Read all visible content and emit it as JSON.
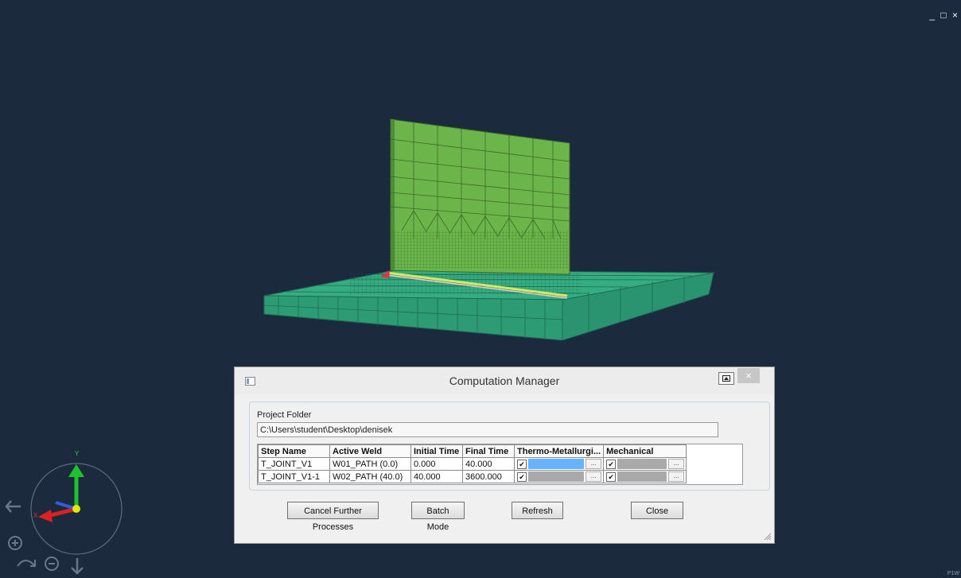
{
  "window_controls": "_ □ ×",
  "corner_tag": "P1W",
  "dialog": {
    "title": "Computation Manager",
    "close_glyph": "×",
    "project_folder_label": "Project Folder",
    "project_folder_value": "C:\\Users\\student\\Desktop\\denisek",
    "table": {
      "columns": [
        "Step Name",
        "Active Weld",
        "Initial Time",
        "Final Time",
        "Thermo-Metallurgi...",
        "Mechanical"
      ],
      "rows": [
        {
          "step": "T_JOINT_V1",
          "weld": "W01_PATH (0.0)",
          "initial": "0.000",
          "final": "40.000",
          "thermo_checked": "✔",
          "thermo_selected": true,
          "mech_checked": "✔"
        },
        {
          "step": "T_JOINT_V1-1",
          "weld": "W02_PATH (40.0)",
          "initial": "40.000",
          "final": "3600.000",
          "thermo_checked": "✔",
          "thermo_selected": false,
          "mech_checked": "✔"
        }
      ],
      "ellipsis": "..."
    },
    "buttons": {
      "cancel": "Cancel Further Processes",
      "batch": "Batch Mode",
      "refresh": "Refresh",
      "close": "Close"
    }
  },
  "triad": {
    "y_label": "Y",
    "x_label": "X"
  },
  "colors": {
    "background": "#1c2a3d",
    "plate": "#2fa67c",
    "web": "#6bb54a",
    "selected_cell": "#66b3ff"
  }
}
